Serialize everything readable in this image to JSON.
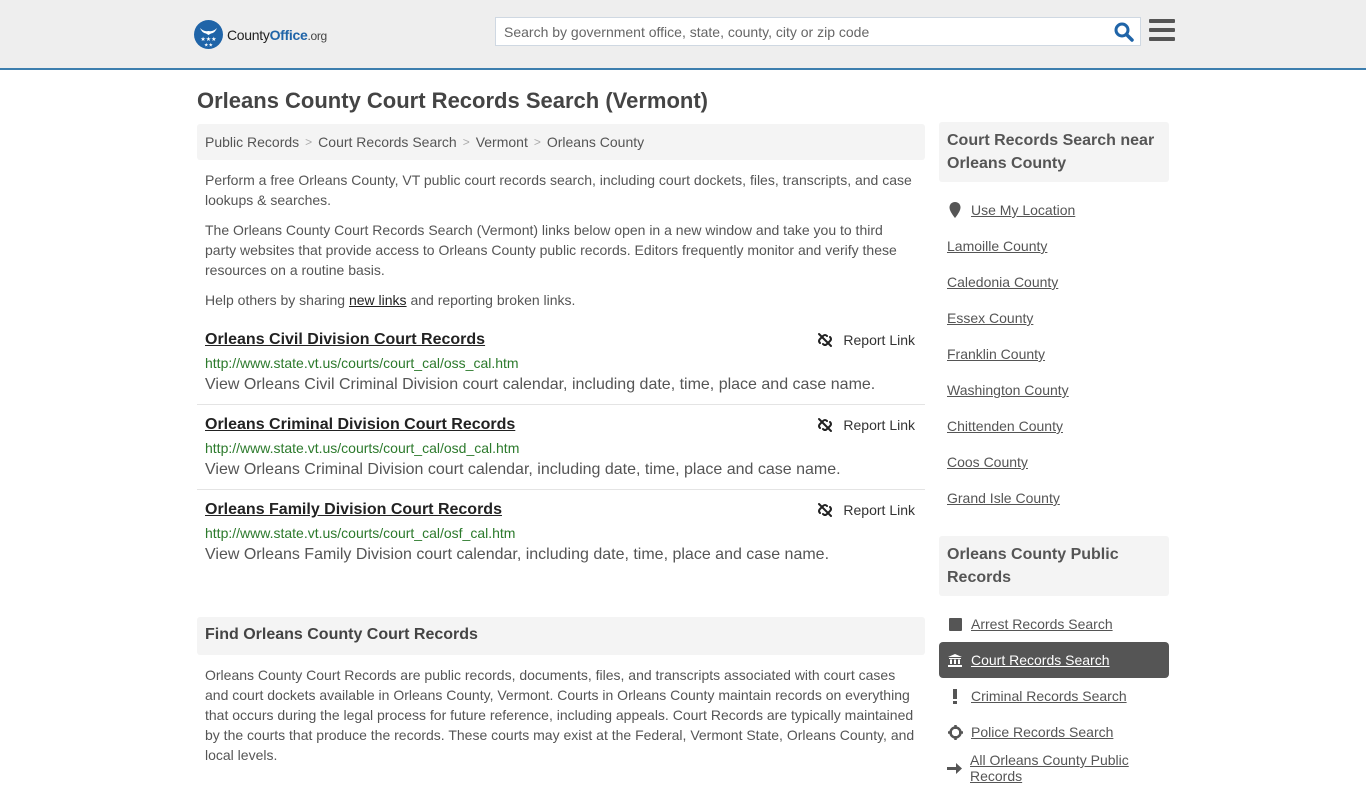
{
  "header": {
    "logo": {
      "brand_part1": "County",
      "brand_part2": "Office",
      "brand_suffix": ".org"
    },
    "search": {
      "placeholder": "Search by government office, state, county, city or zip code",
      "value": ""
    },
    "icons": {
      "search": "search-icon",
      "menu": "hamburger-menu-icon"
    }
  },
  "page": {
    "title": "Orleans County Court Records Search (Vermont)"
  },
  "breadcrumb": [
    {
      "label": "Public Records"
    },
    {
      "label": "Court Records Search"
    },
    {
      "label": "Vermont"
    },
    {
      "label": "Orleans County"
    }
  ],
  "breadcrumb_separator": ">",
  "intro": {
    "p1": "Perform a free Orleans County, VT public court records search, including court dockets, files, transcripts, and case lookups & searches.",
    "p2": "The Orleans County Court Records Search (Vermont) links below open in a new window and take you to third party websites that provide access to Orleans County public records. Editors frequently monitor and verify these resources on a routine basis.",
    "p3_before": "Help others by sharing ",
    "p3_link": "new links",
    "p3_after": " and reporting broken links."
  },
  "records": [
    {
      "title": "Orleans Civil Division Court Records",
      "url": "http://www.state.vt.us/courts/court_cal/oss_cal.htm",
      "description": "View Orleans Civil Criminal Division court calendar, including date, time, place and case name.",
      "report_label": "Report Link"
    },
    {
      "title": "Orleans Criminal Division Court Records",
      "url": "http://www.state.vt.us/courts/court_cal/osd_cal.htm",
      "description": "View Orleans Criminal Division court calendar, including date, time, place and case name.",
      "report_label": "Report Link"
    },
    {
      "title": "Orleans Family Division Court Records",
      "url": "http://www.state.vt.us/courts/court_cal/osf_cal.htm",
      "description": "View Orleans Family Division court calendar, including date, time, place and case name.",
      "report_label": "Report Link"
    }
  ],
  "find_section": {
    "heading": "Find Orleans County Court Records",
    "body": "Orleans County Court Records are public records, documents, files, and transcripts associated with court cases and court dockets available in Orleans County, Vermont. Courts in Orleans County maintain records on everything that occurs during the legal process for future reference, including appeals. Court Records are typically maintained by the courts that produce the records. These courts may exist at the Federal, Vermont State, Orleans County, and local levels."
  },
  "sidebar": {
    "nearby": {
      "heading": "Court Records Search near Orleans County",
      "use_location": "Use My Location",
      "items": [
        "Lamoille County",
        "Caledonia County",
        "Essex County",
        "Franklin County",
        "Washington County",
        "Chittenden County",
        "Coos County",
        "Grand Isle County"
      ]
    },
    "public_records": {
      "heading": "Orleans County Public Records",
      "items": [
        {
          "label": "Arrest Records Search",
          "icon": "square-icon",
          "active": false
        },
        {
          "label": "Court Records Search",
          "icon": "courthouse-icon",
          "active": true
        },
        {
          "label": "Criminal Records Search",
          "icon": "exclamation-icon",
          "active": false
        },
        {
          "label": "Police Records Search",
          "icon": "crosshair-icon",
          "active": false
        },
        {
          "label": "All Orleans County Public Records",
          "icon": "arrow-right-icon",
          "active": false
        }
      ]
    }
  },
  "colors": {
    "brand_blue": "#1f64a8",
    "header_border": "#3d7eae",
    "url_green": "#2c7a2c",
    "active_bg": "#555555"
  }
}
